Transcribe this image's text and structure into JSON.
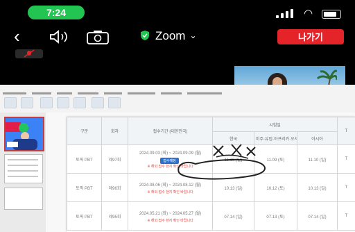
{
  "status_bar": {
    "time": "7:24"
  },
  "toolbar": {
    "title": "Zoom",
    "leave_label": "나가기"
  },
  "colors": {
    "time_pill": "#23c552",
    "leave_button": "#e5242a",
    "shield": "#23c552",
    "badge": "#2b6fcf",
    "note": "#e4473f"
  },
  "icons": [
    "back-icon",
    "speaker-icon",
    "camera-switch-icon",
    "shield-icon",
    "chevron-down-icon",
    "mic-muted-icon"
  ],
  "shared_screen": {
    "table": {
      "headers": {
        "category": "구분",
        "round": "회차",
        "period": "접수기간 (대한민국)",
        "exam_date": "시험일",
        "korea": "한국",
        "region2": "미주·유럽·아프리카·오세아니아",
        "region3": "아시아",
        "region4": "T"
      },
      "rows": [
        {
          "category": "토픽 PBT",
          "round": "제97회",
          "period": "2024.09.03 (화) ~ 2024.09.09 (월)",
          "badge": "접수예정",
          "note": "※ 해외 접수 현지 확인 바랍니다",
          "korea": "11.10 (일)",
          "region2": "11.09 (토)",
          "region3": "11.10 (일)",
          "region4": "T"
        },
        {
          "category": "토픽 PBT",
          "round": "제96회",
          "period": "2024.08.06 (화) ~ 2024.08.12 (월)",
          "badge": "",
          "note": "※ 해외 접수 현지 확인 바랍니다",
          "korea": "10.13 (일)",
          "region2": "10.12 (토)",
          "region3": "10.13 (일)",
          "region4": "T"
        },
        {
          "category": "토픽 PBT",
          "round": "제95회",
          "period": "2024.05.21 (화) ~ 2024.05.27 (월)",
          "badge": "",
          "note": "※ 해외 접수 현지 확인 바랍니다",
          "korea": "07.14 (일)",
          "region2": "07.13 (토)",
          "region3": "07.14 (일)",
          "region4": "T"
        }
      ]
    }
  }
}
